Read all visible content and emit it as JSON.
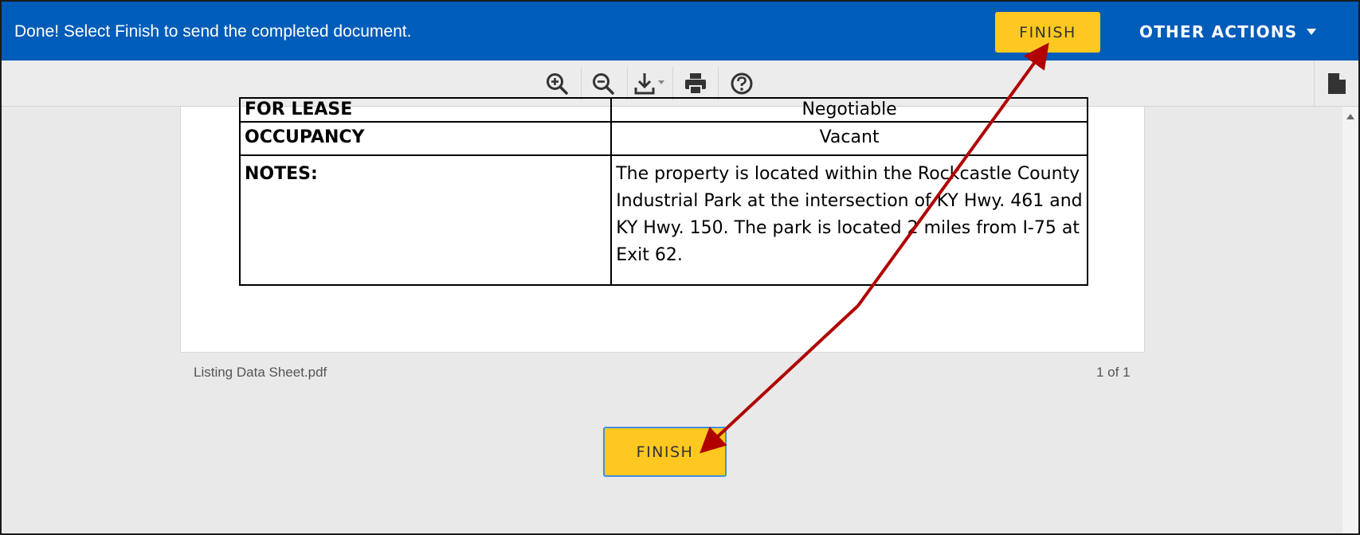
{
  "banner": {
    "message": "Done! Select Finish to send the completed document.",
    "finish_label": "FINISH",
    "other_actions_label": "OTHER ACTIONS",
    "color": "#005cb9",
    "button_color": "#ffc820"
  },
  "toolbar": {
    "tools": [
      {
        "name": "zoom-in-icon"
      },
      {
        "name": "zoom-out-icon"
      },
      {
        "name": "download-icon"
      },
      {
        "name": "print-icon"
      },
      {
        "name": "help-icon"
      },
      {
        "name": "document-panel-icon"
      }
    ]
  },
  "document": {
    "rows": [
      {
        "label": "FOR LEASE",
        "value": "Negotiable"
      },
      {
        "label": "OCCUPANCY",
        "value": "Vacant"
      },
      {
        "label": "NOTES:",
        "value": "The property is located within the Rockcastle County Industrial Park at the intersection of KY Hwy. 461 and KY Hwy. 150.  The park is located 2 miles from I-75 at Exit 62."
      }
    ],
    "file_name": "Listing Data Sheet.pdf",
    "page_count": "1 of 1"
  },
  "footer": {
    "finish_label": "FINISH"
  },
  "annotation": {
    "arrow_color": "#b00000"
  }
}
